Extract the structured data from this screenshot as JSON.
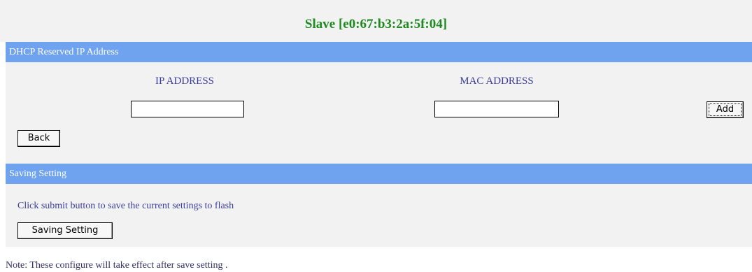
{
  "page": {
    "title": "Slave  [e0:67:b3:2a:5f:04]"
  },
  "dhcp_section": {
    "header": "DHCP Reserved IP Address",
    "ip_column_label": "IP ADDRESS",
    "mac_column_label": "MAC ADDRESS",
    "ip_input_value": "",
    "mac_input_value": "",
    "add_button_label": "Add",
    "back_button_label": "Back"
  },
  "saving_section": {
    "header": "Saving Setting",
    "instruction": "Click submit button to save the current settings to flash",
    "save_button_label": "Saving Setting"
  },
  "footer": {
    "note": "Note: These configure will take effect after save setting ."
  },
  "colors": {
    "title_green": "#1f8a1f",
    "section_bar_blue": "#6fa3ef",
    "panel_gray": "#f2f2f2",
    "label_blue": "#3d3d9a"
  }
}
